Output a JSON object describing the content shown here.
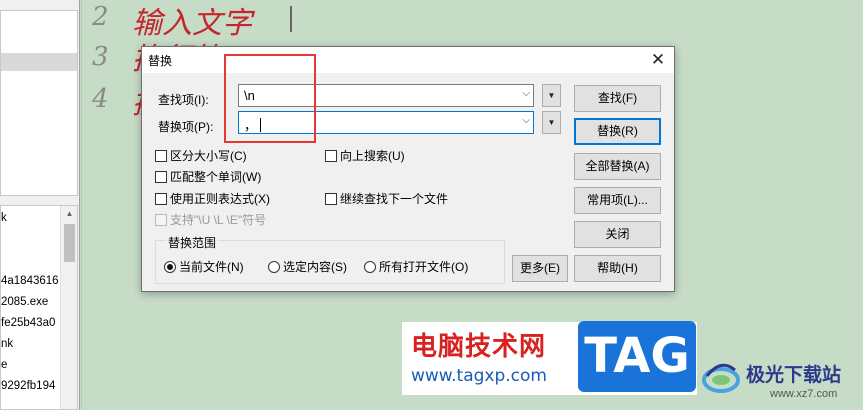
{
  "sidebar": {
    "files": [
      "k",
      "4a1843616",
      "2085.exe",
      "fe25b43a0",
      "nk",
      "e",
      "9292fb194"
    ]
  },
  "editor": {
    "lines": [
      {
        "num": "2",
        "text": "输入文字"
      },
      {
        "num": "3",
        "text": "换行符"
      },
      {
        "num": "4",
        "text": "换"
      }
    ]
  },
  "dialog": {
    "title": "替换",
    "find_label": "查找项(I):",
    "find_value": "\\n",
    "replace_label": "替换项(P):",
    "replace_value": "，",
    "options": {
      "case": "区分大小写(C)",
      "whole_word": "匹配整个单词(W)",
      "regex": "使用正则表达式(X)",
      "escape": "支持\"\\U \\L \\E\"符号",
      "search_up": "向上搜索(U)",
      "continue_next": "继续查找下一个文件"
    },
    "scope": {
      "title": "替换范围",
      "current": "当前文件(N)",
      "selection": "选定内容(S)",
      "all_open": "所有打开文件(O)"
    },
    "buttons": {
      "find": "查找(F)",
      "replace": "替换(R)",
      "replace_all": "全部替换(A)",
      "common": "常用项(L)...",
      "close": "关闭",
      "more": "更多(E)",
      "help": "帮助(H)"
    }
  },
  "watermark": {
    "site_cn": "电脑技术网",
    "tag": "TAG",
    "url": "www.tagxp.com",
    "site2_cn": "极光下载站",
    "site2_url": "www.xz7.com"
  },
  "colors": {
    "editor_bg": "#c7dcc7",
    "editor_text": "#c4262e",
    "highlight": "#e53935",
    "accent": "#0078d7"
  }
}
